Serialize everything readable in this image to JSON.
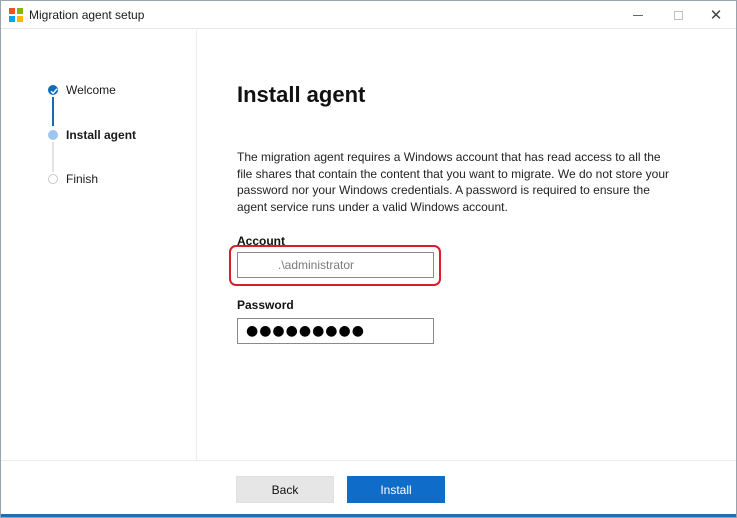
{
  "window": {
    "title": "Migration agent setup",
    "logo_colors": [
      "#f25022",
      "#7fba00",
      "#00a4ef",
      "#ffb900"
    ],
    "minimize_glyph": "—",
    "maximize_glyph": "☐",
    "close_glyph": "✕"
  },
  "steps": [
    {
      "label": "Welcome",
      "state": "completed"
    },
    {
      "label": "Install agent",
      "state": "current"
    },
    {
      "label": "Finish",
      "state": "pending"
    }
  ],
  "main": {
    "title": "Install agent",
    "description": "The migration agent requires a Windows account that has read access to all the file shares that contain the content that you want to migrate. We do not store your password nor your Windows credentials. A password is required to ensure the agent service runs under a valid Windows account.",
    "account_label": "Account",
    "account_value": ".\\administrator",
    "password_label": "Password",
    "password_value": "●●●●●●●●●"
  },
  "footer": {
    "back_label": "Back",
    "install_label": "Install"
  },
  "colors": {
    "accent": "#0f6cc8",
    "highlight": "#e01a2b",
    "step_current": "#9ec5ef"
  }
}
